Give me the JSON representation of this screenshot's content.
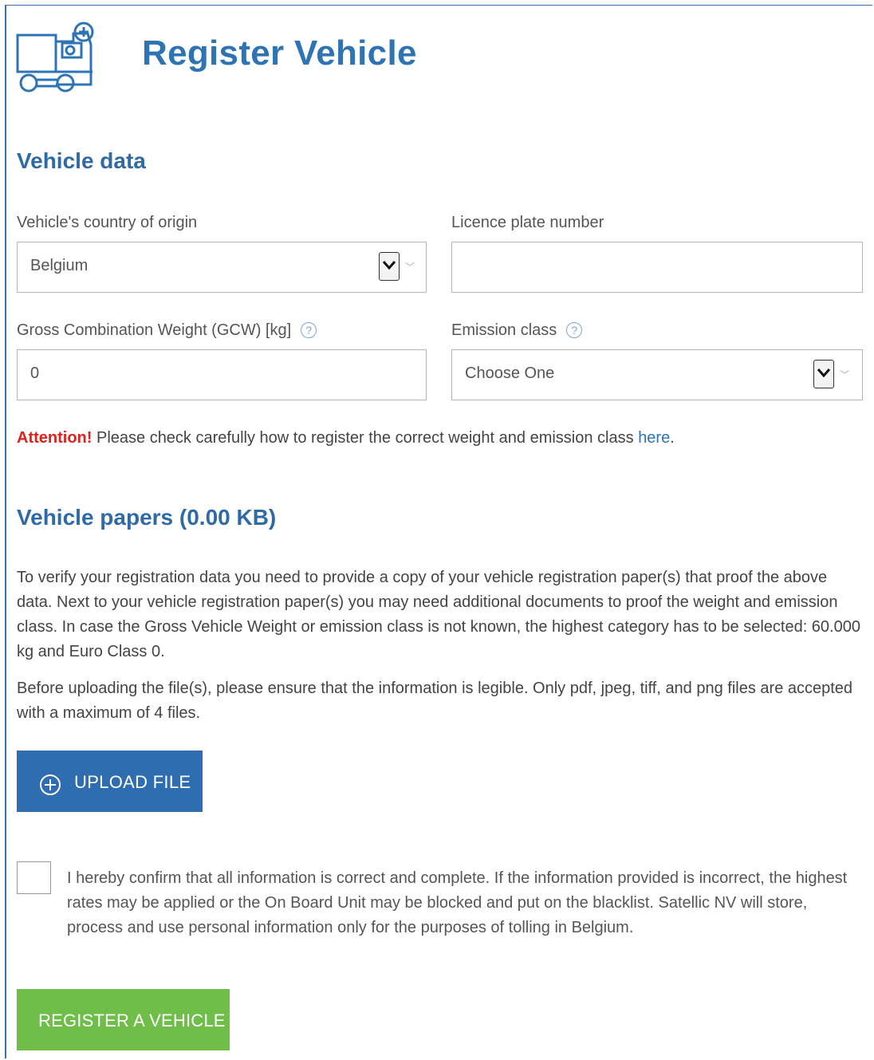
{
  "header": {
    "title": "Register Vehicle",
    "logo_icon": "truck-plus-icon"
  },
  "vehicle_data": {
    "heading": "Vehicle data",
    "country": {
      "label": "Vehicle's country of origin",
      "value": "Belgium"
    },
    "plate": {
      "label": "Licence plate number",
      "value": ""
    },
    "gcw": {
      "label": "Gross Combination Weight (GCW) [kg]",
      "value": "0",
      "help_icon": "question-icon"
    },
    "emission": {
      "label": "Emission class",
      "value": "Choose One",
      "help_icon": "question-icon"
    },
    "attention": {
      "prefix": "Attention!",
      "text": " Please check carefully how to register the correct weight and emission class ",
      "link": "here",
      "suffix": "."
    }
  },
  "papers": {
    "heading": "Vehicle papers (0.00 KB)",
    "paragraph1": "To verify your registration data you need to provide a copy of your vehicle registration paper(s) that proof the above data. Next to your vehicle registration paper(s) you may need additional documents to proof the weight and emission class. In case the Gross Vehicle Weight or emission class is not known, the highest category has to be selected: 60.000 kg and Euro Class 0.",
    "paragraph2": "Before uploading the file(s), please ensure that the information is legible. Only pdf, jpeg, tiff, and png files are accepted with a maximum of 4 files.",
    "upload_label": "UPLOAD FILE"
  },
  "confirm": {
    "checked": false,
    "text": "I hereby confirm that all information is correct and complete. If the information provided is incorrect, the highest rates may be applied or the On Board Unit may be blocked and put on the blacklist. Satellic NV will store, process and use personal information only for the purposes of tolling in Belgium."
  },
  "register_label": "REGISTER A VEHICLE",
  "colors": {
    "primary": "#2e6db0",
    "heading": "#2e74b5",
    "warning": "#e0211b",
    "register": "#6fbe4a"
  }
}
